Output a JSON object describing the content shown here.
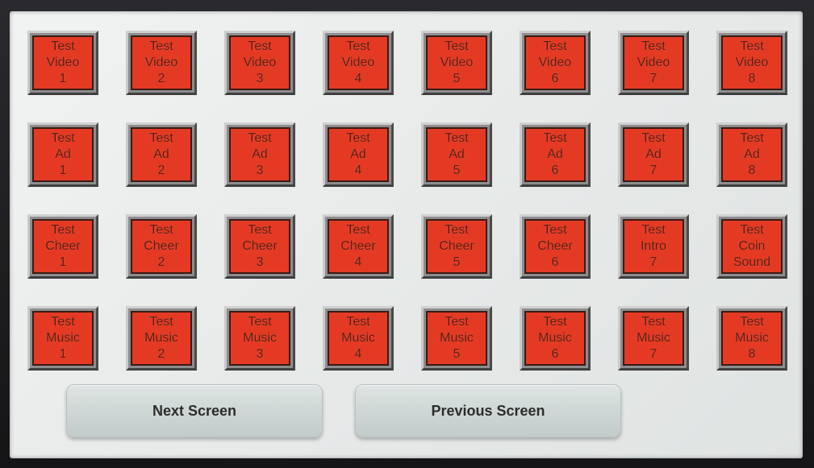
{
  "grid": {
    "rows": [
      [
        [
          "Test",
          "Video",
          "1"
        ],
        [
          "Test",
          "Video",
          "2"
        ],
        [
          "Test",
          "Video",
          "3"
        ],
        [
          "Test",
          "Video",
          "4"
        ],
        [
          "Test",
          "Video",
          "5"
        ],
        [
          "Test",
          "Video",
          "6"
        ],
        [
          "Test",
          "Video",
          "7"
        ],
        [
          "Test",
          "Video",
          "8"
        ]
      ],
      [
        [
          "Test",
          "Ad",
          "1"
        ],
        [
          "Test",
          "Ad",
          "2"
        ],
        [
          "Test",
          "Ad",
          "3"
        ],
        [
          "Test",
          "Ad",
          "4"
        ],
        [
          "Test",
          "Ad",
          "5"
        ],
        [
          "Test",
          "Ad",
          "6"
        ],
        [
          "Test",
          "Ad",
          "7"
        ],
        [
          "Test",
          "Ad",
          "8"
        ]
      ],
      [
        [
          "Test",
          "Cheer",
          "1"
        ],
        [
          "Test",
          "Cheer",
          "2"
        ],
        [
          "Test",
          "Cheer",
          "3"
        ],
        [
          "Test",
          "Cheer",
          "4"
        ],
        [
          "Test",
          "Cheer",
          "5"
        ],
        [
          "Test",
          "Cheer",
          "6"
        ],
        [
          "Test",
          "Intro",
          "7"
        ],
        [
          "Test",
          "Coin",
          "Sound"
        ]
      ],
      [
        [
          "Test",
          "Music",
          "1"
        ],
        [
          "Test",
          "Music",
          "2"
        ],
        [
          "Test",
          "Music",
          "3"
        ],
        [
          "Test",
          "Music",
          "4"
        ],
        [
          "Test",
          "Music",
          "5"
        ],
        [
          "Test",
          "Music",
          "6"
        ],
        [
          "Test",
          "Music",
          "7"
        ],
        [
          "Test",
          "Music",
          "8"
        ]
      ]
    ]
  },
  "nav": {
    "next_label": "Next Screen",
    "previous_label": "Previous Screen"
  },
  "colors": {
    "button_face": "#e43a24",
    "button_text": "#5a1d12",
    "screen_background": "#eceeed",
    "nav_button": "#d3dbd9"
  }
}
